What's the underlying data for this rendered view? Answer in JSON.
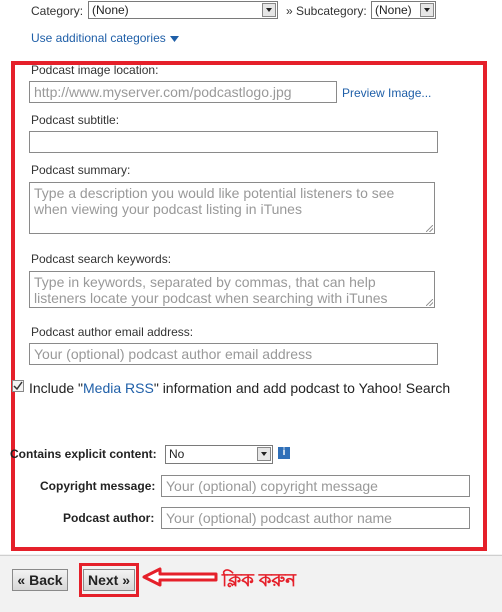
{
  "category": {
    "label": "Category:",
    "value": "(None)"
  },
  "subcategory": {
    "label": "» Subcategory:",
    "value": "(None)"
  },
  "additional_categories_link": "Use additional categories",
  "image_location": {
    "label": "Podcast image location:",
    "placeholder": "http://www.myserver.com/podcastlogo.jpg",
    "preview_link": "Preview Image..."
  },
  "subtitle": {
    "label": "Podcast subtitle:"
  },
  "summary": {
    "label": "Podcast summary:",
    "placeholder": "Type a description you would like potential listeners to see when viewing your podcast listing in iTunes"
  },
  "keywords": {
    "label": "Podcast search keywords:",
    "placeholder": "Type in keywords, separated by commas, that can help listeners locate your podcast when searching with iTunes"
  },
  "author_email": {
    "label": "Podcast author email address:",
    "placeholder": "Your (optional) podcast author email address"
  },
  "media_rss": {
    "prefix": "Include \"",
    "link": "Media RSS",
    "suffix": "\" information and add podcast to Yahoo! Search",
    "checked": true
  },
  "explicit": {
    "label": "Contains explicit content:",
    "value": "No"
  },
  "copyright": {
    "label": "Copyright message:",
    "placeholder": "Your (optional) copyright message"
  },
  "author": {
    "label": "Podcast author:",
    "placeholder": "Your (optional) podcast author name"
  },
  "nav": {
    "back_label": "« Back",
    "next_label": "Next »"
  },
  "annotation": {
    "text": "ক্লিক করুন",
    "color": "#e5202a"
  }
}
